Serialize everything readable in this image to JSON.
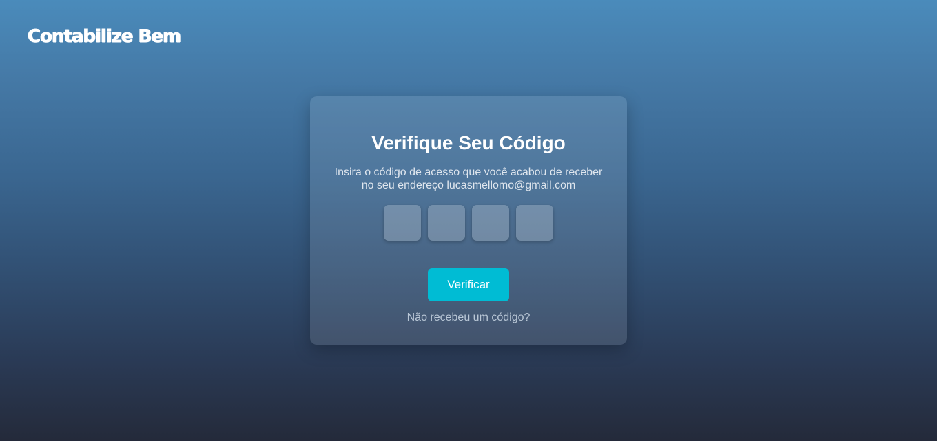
{
  "brand": {
    "logo_text": "Contabilize Bem"
  },
  "verification": {
    "title": "Verifique Seu Código",
    "description": "Insira o código de acesso que você acabou de receber no seu endereço lucasmellomo@gmail.com",
    "code_inputs": [
      "",
      "",
      "",
      ""
    ],
    "verify_label": "Verificar",
    "resend_label": "Não recebeu um código?"
  },
  "colors": {
    "accent": "#00bcd4",
    "background_top": "#4a8bbb",
    "background_bottom": "#242a3a"
  }
}
